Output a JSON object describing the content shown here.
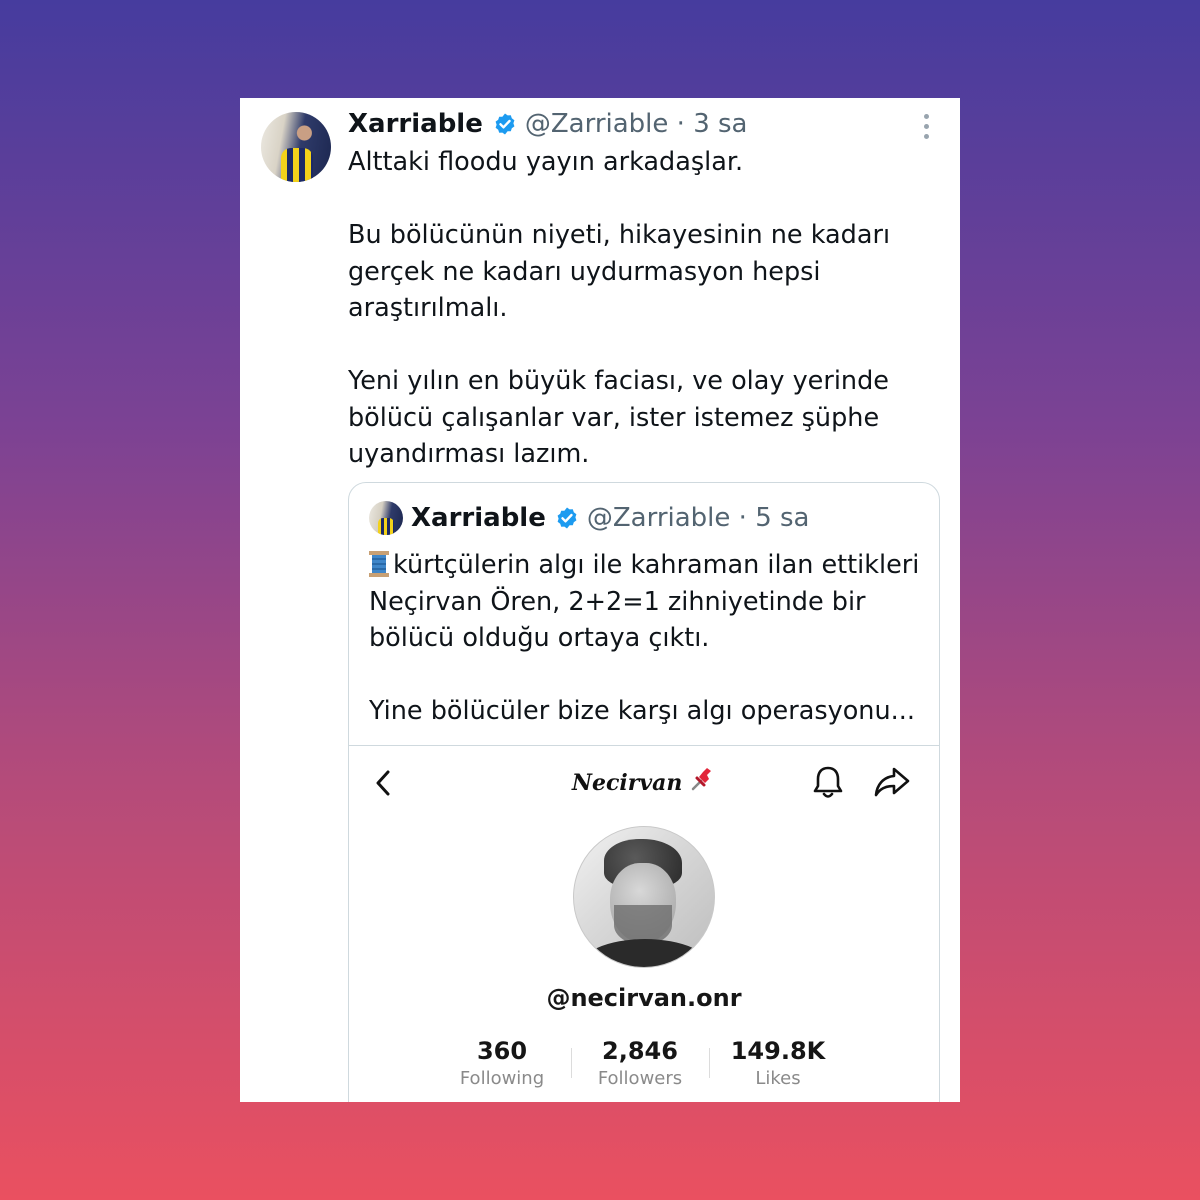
{
  "tweet": {
    "author_name": "Xarriable",
    "handle_time": "@Zarriable · 3 sa",
    "paragraphs": [
      "Alttaki floodu yayın arkadaşlar.",
      "Bu bölücünün niyeti, hikayesinin ne kadarı gerçek ne kadarı uydurmasyon hepsi araştırılmalı.",
      "Yeni yılın en büyük faciası, ve olay yerinde bölücü çalışanlar var, ister istemez şüphe uyandırması lazım."
    ]
  },
  "quote": {
    "author_name": "Xarriable",
    "handle_time": "@Zarriable · 5 sa",
    "line1": "kürtçülerin algı ile kahraman ilan ettikleri Neçirvan Ören, 2+2=1 zihniyetinde bir bölücü olduğu ortaya çıktı.",
    "line2": "Yine bölücüler bize karşı algı operasyonu..."
  },
  "profile_screenshot": {
    "title": "Necirvan",
    "username": "@necirvan.onr",
    "stats": [
      {
        "value": "360",
        "label": "Following"
      },
      {
        "value": "2,846",
        "label": "Followers"
      },
      {
        "value": "149.8K",
        "label": "Likes"
      }
    ]
  },
  "colors": {
    "verified": "#1d9bf0",
    "text": "#0f1419",
    "muted": "#536471"
  },
  "icons": [
    "verified-badge-icon",
    "more-options-icon",
    "spool-icon",
    "back-chevron-icon",
    "pushpin-icon",
    "bell-icon",
    "share-arrow-icon"
  ]
}
